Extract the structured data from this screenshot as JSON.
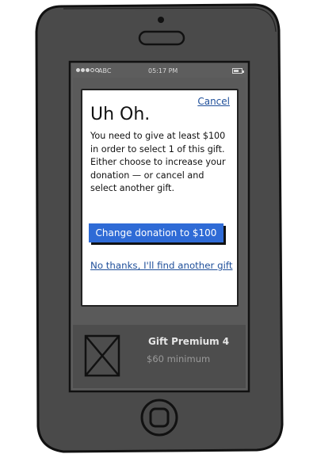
{
  "status_bar": {
    "carrier": "ABC",
    "time": "05:17 PM"
  },
  "modal": {
    "cancel_label": "Cancel",
    "title": "Uh Oh.",
    "message": "You need to give at least $100 in order to select 1 of this gift. Either choose to increase your donation — or cancel and select another gift.",
    "primary_button": "Change donation to $100",
    "secondary_link": "No thanks, I'll find another gift"
  },
  "gift": {
    "name": "Gift Premium 4",
    "minimum": "$60 minimum"
  },
  "colors": {
    "phone_body": "#4a4a4a",
    "screen_bg": "#5a5a5a",
    "primary_button": "#2f6bd6",
    "link": "#1f4f9a"
  }
}
